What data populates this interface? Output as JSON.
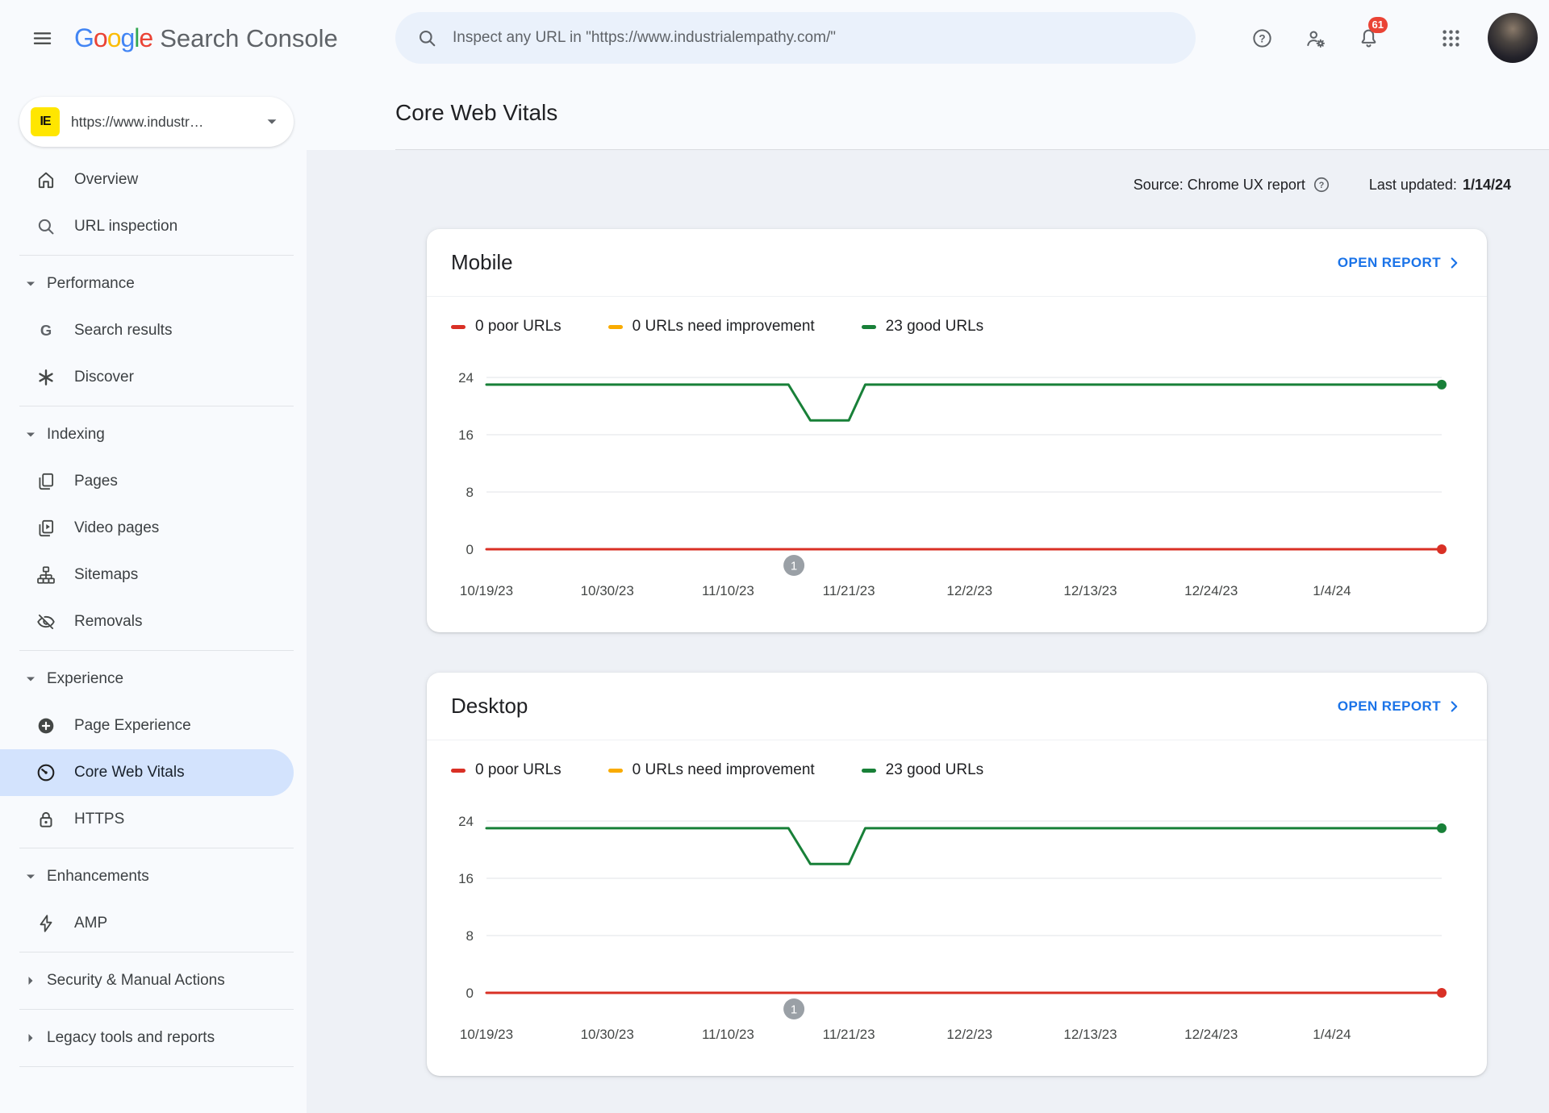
{
  "theme": {
    "google_letter_colors": [
      "#4285F4",
      "#EA4335",
      "#FBBC05",
      "#4285F4",
      "#34A853",
      "#EA4335"
    ],
    "accent_blue": "#1a73e8",
    "active_item_bg": "#d3e3fd",
    "good_color": "#188038",
    "poor_color": "#d93025",
    "needs_improvement_color": "#f9ab00",
    "notification_badge_color": "#ea4335",
    "annotation_badge_color": "#9aa0a6"
  },
  "topbar": {
    "brand": "Google",
    "product": "Search Console",
    "search_placeholder": "Inspect any URL in \"https://www.industrialempathy.com/\"",
    "notification_count": "61"
  },
  "sidebar": {
    "property": {
      "favicon_text": "IE",
      "label": "https://www.industr…"
    },
    "groups": [
      {
        "items": [
          {
            "icon": "home",
            "label": "Overview"
          },
          {
            "icon": "search",
            "label": "URL inspection"
          }
        ]
      },
      {
        "header": {
          "label": "Performance",
          "expanded": true
        },
        "items": [
          {
            "icon": "g",
            "label": "Search results"
          },
          {
            "icon": "discover",
            "label": "Discover"
          }
        ]
      },
      {
        "header": {
          "label": "Indexing",
          "expanded": true
        },
        "items": [
          {
            "icon": "pages",
            "label": "Pages"
          },
          {
            "icon": "video",
            "label": "Video pages"
          },
          {
            "icon": "sitemaps",
            "label": "Sitemaps"
          },
          {
            "icon": "removals",
            "label": "Removals"
          }
        ]
      },
      {
        "header": {
          "label": "Experience",
          "expanded": true
        },
        "items": [
          {
            "icon": "page-experience",
            "label": "Page Experience"
          },
          {
            "icon": "core-web-vitals",
            "label": "Core Web Vitals",
            "active": true
          },
          {
            "icon": "https",
            "label": "HTTPS"
          }
        ]
      },
      {
        "header": {
          "label": "Enhancements",
          "expanded": true
        },
        "items": [
          {
            "icon": "amp",
            "label": "AMP"
          }
        ]
      },
      {
        "header": {
          "label": "Security & Manual Actions",
          "expanded": false
        },
        "items": []
      },
      {
        "header": {
          "label": "Legacy tools and reports",
          "expanded": false
        },
        "items": []
      }
    ]
  },
  "main": {
    "title": "Core Web Vitals",
    "source_label": "Source: Chrome UX report",
    "last_updated_label": "Last updated:",
    "last_updated_value": "1/14/24",
    "open_report_label": "OPEN REPORT",
    "cards": [
      {
        "title": "Mobile",
        "legend": [
          {
            "color": "#d93025",
            "label": "0 poor URLs"
          },
          {
            "color": "#f9ab00",
            "label": "0 URLs need improvement"
          },
          {
            "color": "#188038",
            "label": "23 good URLs"
          }
        ]
      },
      {
        "title": "Desktop",
        "legend": [
          {
            "color": "#d93025",
            "label": "0 poor URLs"
          },
          {
            "color": "#f9ab00",
            "label": "0 URLs need improvement"
          },
          {
            "color": "#188038",
            "label": "23 good URLs"
          }
        ]
      }
    ]
  },
  "chart_data": [
    {
      "type": "line",
      "device": "Mobile",
      "x_unit": "days since 10/19/23",
      "x_range": [
        0,
        87
      ],
      "ylim": [
        0,
        24
      ],
      "yticks": [
        0,
        8,
        16,
        24
      ],
      "xticks": [
        {
          "day": 0,
          "label": "10/19/23"
        },
        {
          "day": 11,
          "label": "10/30/23"
        },
        {
          "day": 22,
          "label": "11/10/23"
        },
        {
          "day": 33,
          "label": "11/21/23"
        },
        {
          "day": 44,
          "label": "12/2/23"
        },
        {
          "day": 55,
          "label": "12/13/23"
        },
        {
          "day": 66,
          "label": "12/24/23"
        },
        {
          "day": 77,
          "label": "1/4/24"
        }
      ],
      "series": [
        {
          "name": "good URLs",
          "color": "#188038",
          "points": [
            [
              0,
              23
            ],
            [
              27.5,
              23
            ],
            [
              29.5,
              18
            ],
            [
              33,
              18
            ],
            [
              34.5,
              23
            ],
            [
              87,
              23
            ]
          ]
        },
        {
          "name": "poor URLs",
          "color": "#d93025",
          "points": [
            [
              0,
              0
            ],
            [
              87,
              0
            ]
          ]
        }
      ],
      "annotations": [
        {
          "day": 28,
          "label": "1"
        }
      ]
    },
    {
      "type": "line",
      "device": "Desktop",
      "x_unit": "days since 10/19/23",
      "x_range": [
        0,
        87
      ],
      "ylim": [
        0,
        24
      ],
      "yticks": [
        0,
        8,
        16,
        24
      ],
      "xticks": [
        {
          "day": 0,
          "label": "10/19/23"
        },
        {
          "day": 11,
          "label": "10/30/23"
        },
        {
          "day": 22,
          "label": "11/10/23"
        },
        {
          "day": 33,
          "label": "11/21/23"
        },
        {
          "day": 44,
          "label": "12/2/23"
        },
        {
          "day": 55,
          "label": "12/13/23"
        },
        {
          "day": 66,
          "label": "12/24/23"
        },
        {
          "day": 77,
          "label": "1/4/24"
        }
      ],
      "series": [
        {
          "name": "good URLs",
          "color": "#188038",
          "points": [
            [
              0,
              23
            ],
            [
              27.5,
              23
            ],
            [
              29.5,
              18
            ],
            [
              33,
              18
            ],
            [
              34.5,
              23
            ],
            [
              87,
              23
            ]
          ]
        },
        {
          "name": "poor URLs",
          "color": "#d93025",
          "points": [
            [
              0,
              0
            ],
            [
              87,
              0
            ]
          ]
        }
      ],
      "annotations": [
        {
          "day": 28,
          "label": "1"
        }
      ]
    }
  ]
}
